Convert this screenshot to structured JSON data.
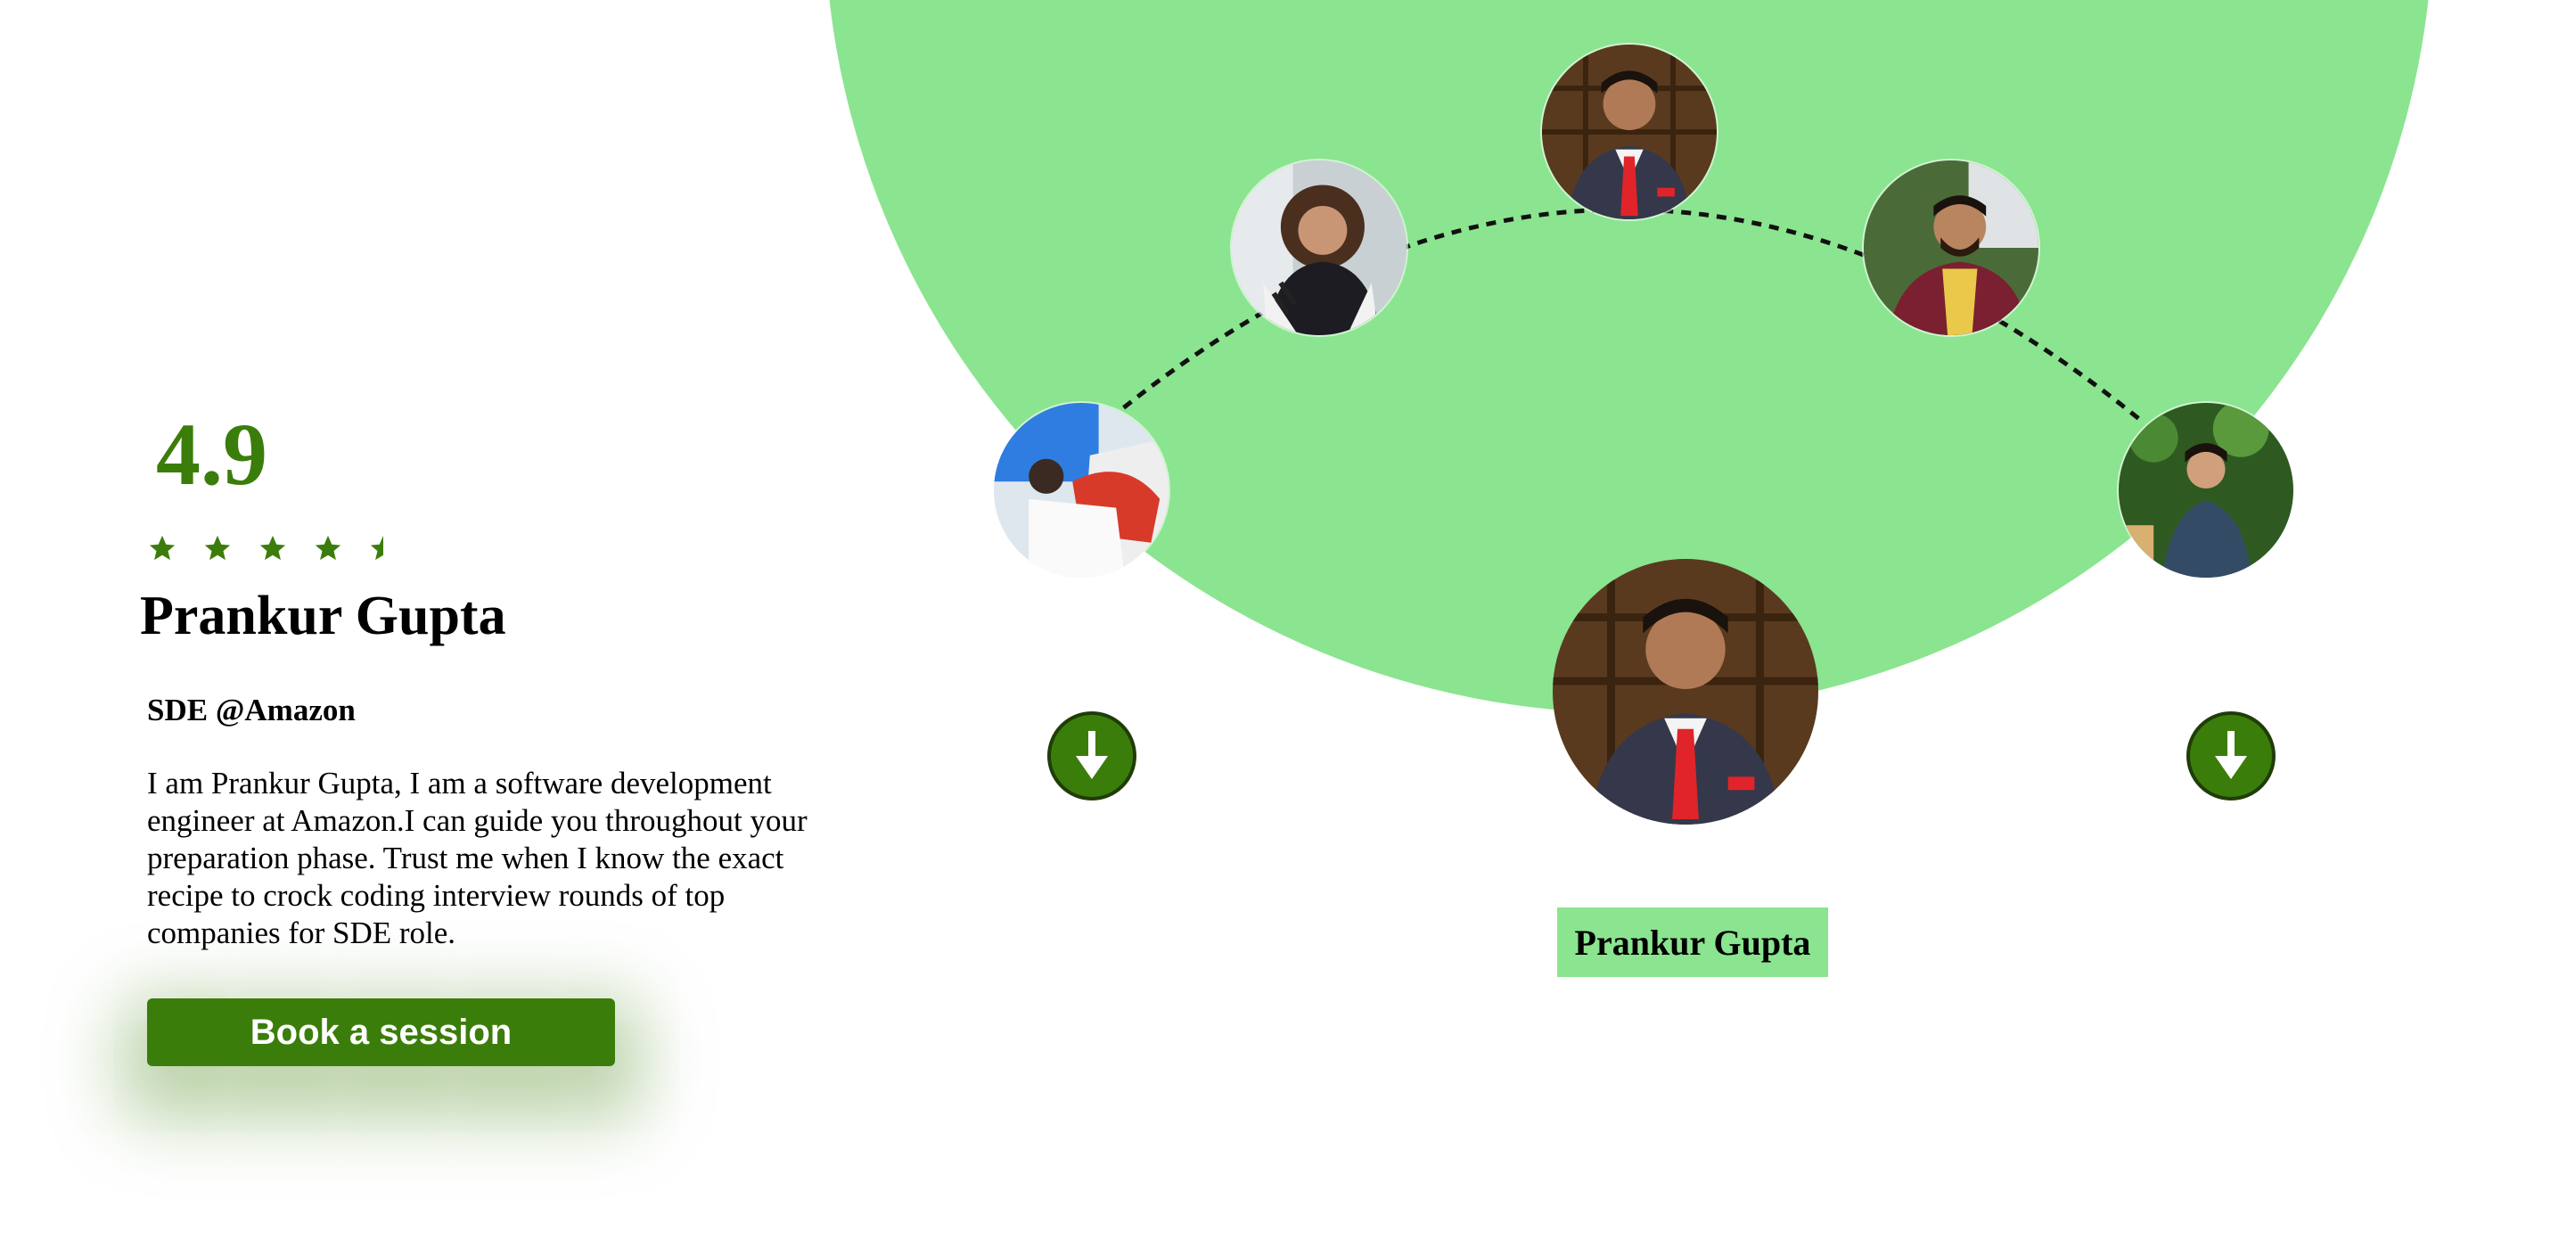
{
  "mentor": {
    "rating": "4.9",
    "stars_full": 4,
    "stars_half": 1,
    "name": "Prankur Gupta",
    "role": "SDE @Amazon",
    "bio": "I am Prankur Gupta, I am a software development engineer at Amazon.I can guide you throughout your preparation phase. Trust me when I know the exact recipe to crock coding interview rounds of top companies for SDE role.",
    "cta_label": "Book a session"
  },
  "carousel": {
    "selected_name": "Prankur Gupta",
    "prev_icon": "arrow-down-icon",
    "next_icon": "arrow-down-icon"
  },
  "colors": {
    "accent": "#3b7d0a",
    "disc": "#8be48f",
    "text": "#000000"
  }
}
